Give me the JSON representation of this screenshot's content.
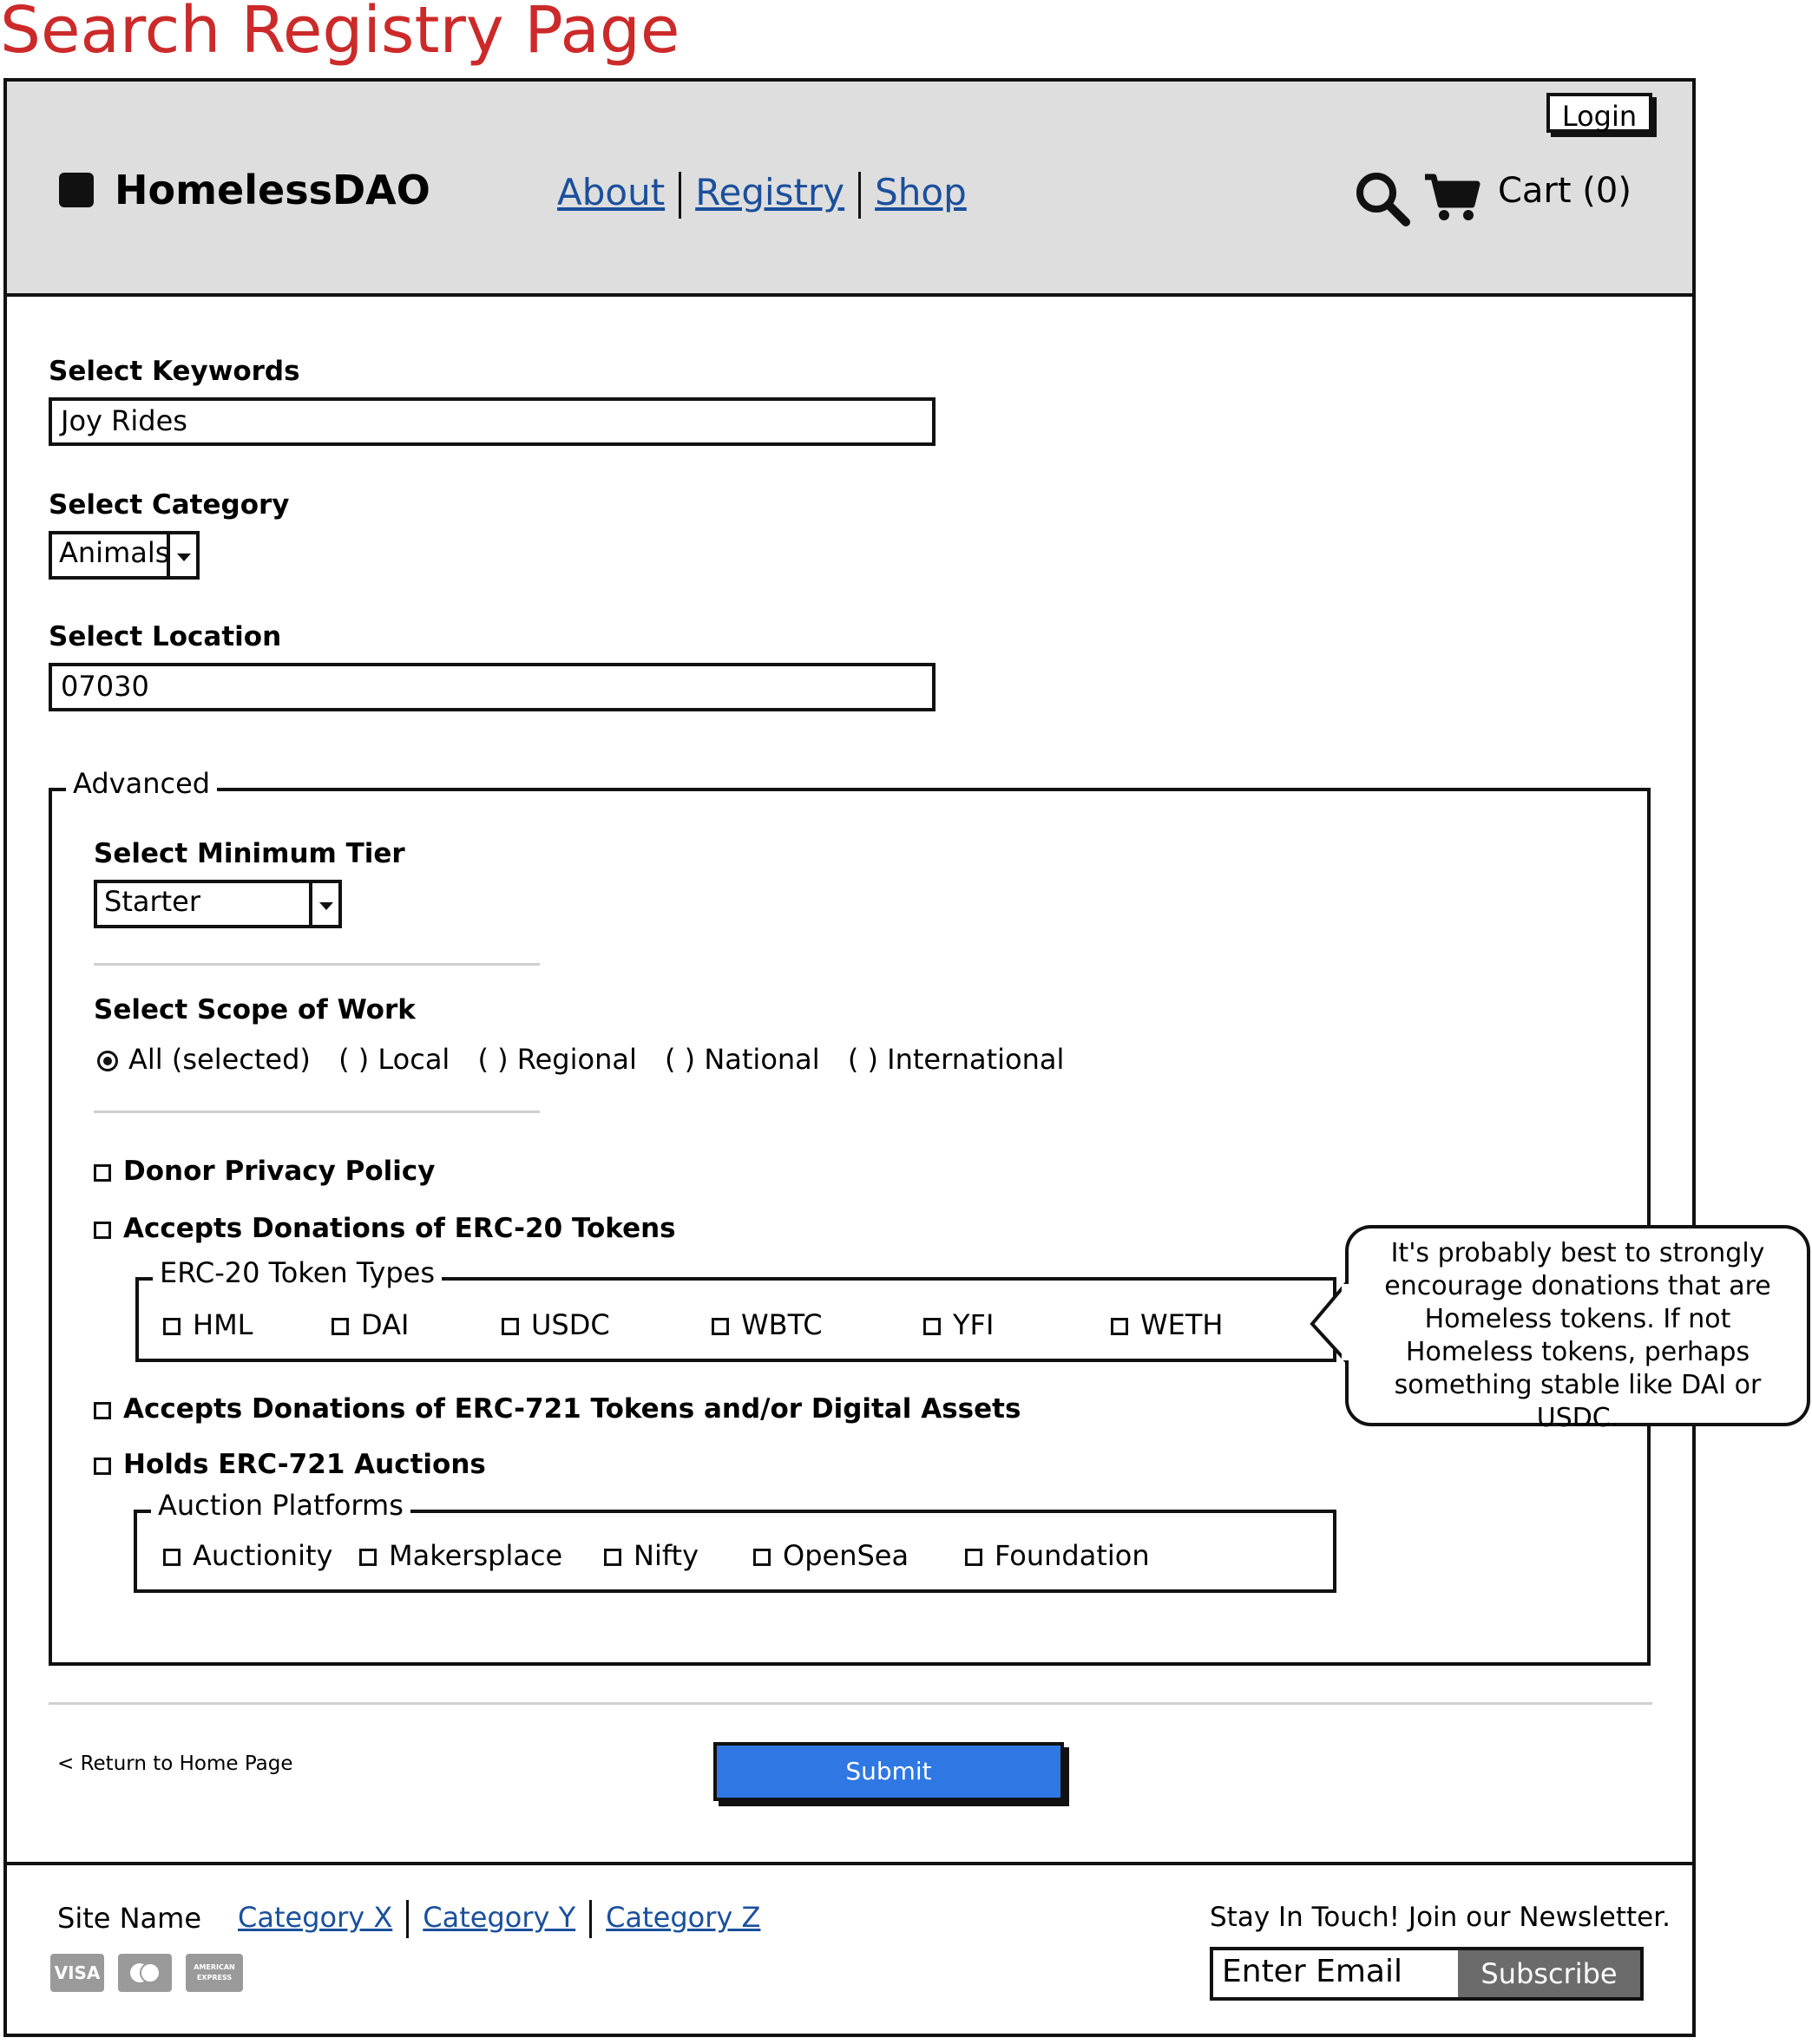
{
  "page_title": "Search Registry Page",
  "header": {
    "login_label": "Login",
    "logo_text": "HomelessDAO",
    "nav": [
      "About",
      "Registry",
      "Shop"
    ],
    "cart_label": "Cart (0)"
  },
  "form": {
    "keywords_label": "Select Keywords",
    "keywords_value": "Joy Rides",
    "category_label": "Select Category",
    "category_value": "Animals",
    "location_label": "Select Location",
    "location_value": "07030"
  },
  "advanced": {
    "legend": "Advanced",
    "tier_label": "Select Minimum Tier",
    "tier_value": "Starter",
    "scope_label": "Select Scope of Work",
    "scope_options": [
      "All (selected)",
      "( ) Local",
      "( ) Regional",
      "( ) National",
      "( ) International"
    ],
    "donor_privacy": "Donor Privacy Policy",
    "erc20": "Accepts Donations of ERC-20 Tokens",
    "erc20_legend": "ERC-20 Token Types",
    "erc20_tokens": [
      "HML",
      "DAI",
      "USDC",
      "WBTC",
      "YFI",
      "WETH"
    ],
    "erc721": "Accepts Donations of ERC-721 Tokens and/or Digital Assets",
    "auctions": "Holds ERC-721 Auctions",
    "auction_legend": "Auction Platforms",
    "auction_platforms": [
      "Auctionity",
      "Makersplace",
      "Nifty",
      "OpenSea",
      "Foundation"
    ]
  },
  "callout": "It's probably best to strongly encourage donations that are Homeless tokens.  If not Homeless tokens, perhaps something stable like DAI or USDC.",
  "actions": {
    "return_link": "< Return to Home Page",
    "submit_label": "Submit"
  },
  "footer": {
    "site_name": "Site Name",
    "categories": [
      "Category X",
      "Category Y",
      "Category Z"
    ],
    "newsletter_text": "Stay In Touch! Join our Newsletter.",
    "email_placeholder": "Enter Email",
    "subscribe_label": "Subscribe",
    "cards": [
      "VISA",
      "",
      "AMERICAN EXPRESS"
    ]
  },
  "colors": {
    "title_red": "#cc2a2a",
    "link_blue": "#1a4f9c",
    "submit_blue": "#2f78e4",
    "header_gray": "#dedede"
  }
}
